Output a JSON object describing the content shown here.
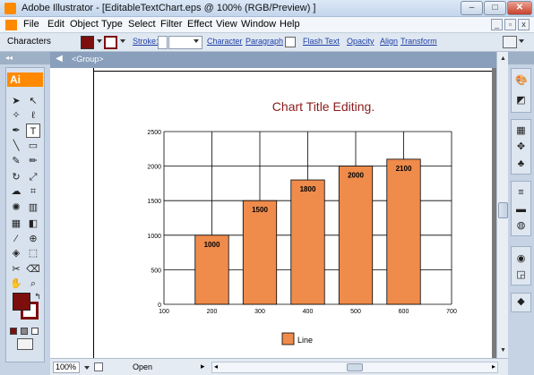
{
  "window": {
    "title": "Adobe Illustrator - [EditableTextChart.eps @ 100% (RGB/Preview) ]",
    "minimize": "–",
    "maximize": "□",
    "close": "✕"
  },
  "menu": {
    "items": [
      "File",
      "Edit",
      "Object",
      "Type",
      "Select",
      "Filter",
      "Effect",
      "View",
      "Window",
      "Help"
    ]
  },
  "control_bar": {
    "selection_label": "Characters",
    "stroke_label": "Stroke:",
    "links": [
      "Character",
      "Paragraph",
      "Flash Text",
      "Opacity",
      "Align",
      "Transform"
    ]
  },
  "breadcrumb": {
    "label": "<Group>"
  },
  "toolbox": {
    "badge": "Ai"
  },
  "status": {
    "zoom": "100%",
    "state": "Open"
  },
  "colors": {
    "fill": "#7d0e0e",
    "bar": "#ef8b4b",
    "title": "#8b1a1a",
    "brand": "#ff8a00"
  },
  "chart_data": {
    "type": "bar",
    "title": "Chart Title Editing.",
    "x": [
      100,
      200,
      300,
      400,
      500,
      600,
      700
    ],
    "categories": [
      200,
      300,
      400,
      500,
      600
    ],
    "values": [
      1000,
      1500,
      1800,
      2000,
      2100
    ],
    "y_ticks": [
      0,
      500,
      1000,
      1500,
      2000,
      2500
    ],
    "ylim": [
      0,
      2500
    ],
    "xlim": [
      100,
      700
    ],
    "grid": true,
    "legend": {
      "entries": [
        "Line"
      ],
      "placement": "bottom"
    },
    "series": [
      {
        "name": "Line",
        "values": [
          1000,
          1500,
          1800,
          2000,
          2100
        ]
      }
    ]
  }
}
